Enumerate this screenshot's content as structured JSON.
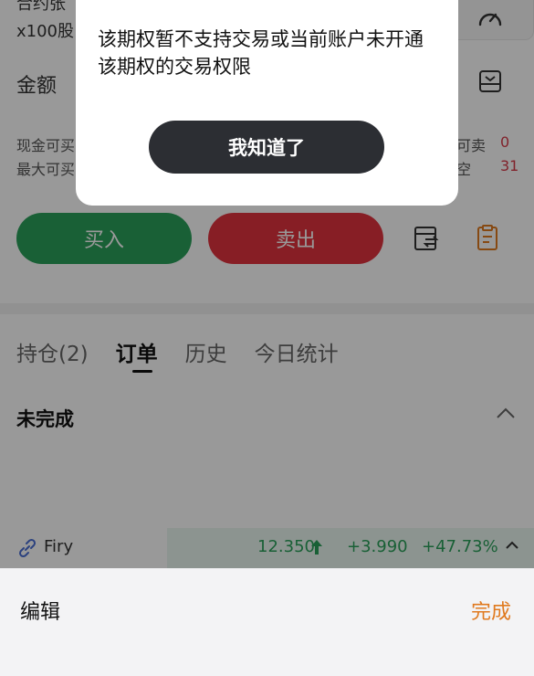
{
  "order_form": {
    "contract_label": "合约张",
    "lot_label": "x100股",
    "amount_label": "金额",
    "cash_buy_label": "现金可买",
    "max_buy_label": "最大可买",
    "can_sell_label": "可卖",
    "can_sell_value": "0",
    "short_label": "空",
    "short_value": "31",
    "buy_label": "买入",
    "sell_label": "卖出"
  },
  "tabs": [
    {
      "label": "持仓(2)"
    },
    {
      "label": "订单"
    },
    {
      "label": "历史"
    },
    {
      "label": "今日统计"
    }
  ],
  "orders": {
    "unfinished_label": "未完成"
  },
  "ticker": {
    "name": "Firy",
    "price": "12.350",
    "change": "+3.990",
    "change_pct": "+47.73%"
  },
  "dialog": {
    "message": "该期权暂不支持交易或当前账户未开通该期权的交易权限",
    "button_label": "我知道了"
  },
  "edit_bar": {
    "edit_label": "编辑",
    "done_label": "完成"
  },
  "colors": {
    "buy": "#2aa05a",
    "sell": "#e2333f",
    "accent": "#e07a1f",
    "dialog_button": "#2c2e33"
  },
  "icons": [
    "speedometer-icon",
    "calculator-icon",
    "swap-icon",
    "clipboard-icon",
    "chevron-up-icon",
    "link-icon",
    "up-arrow-icon"
  ]
}
